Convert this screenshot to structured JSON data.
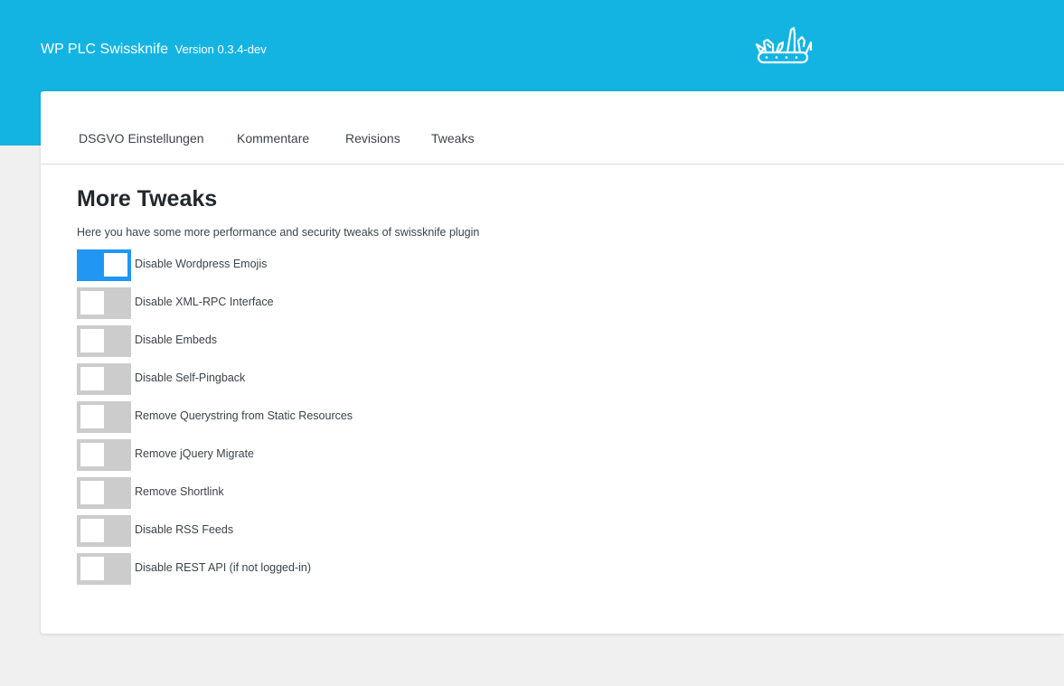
{
  "header": {
    "title": "WP PLC Swissknife",
    "version": "Version 0.3.4-dev",
    "logo_icon": "swiss-knife-icon",
    "background_color": "#13b4e2"
  },
  "tabs": [
    {
      "label": "DSGVO Einstellungen"
    },
    {
      "label": "Kommentare"
    },
    {
      "label": "Revisions"
    },
    {
      "label": "Tweaks"
    }
  ],
  "main": {
    "title": "More Tweaks",
    "description": "Here you have some more performance and security tweaks of swissknife plugin",
    "toggle_on_color": "#2196f3",
    "toggle_off_color": "#cccccc",
    "options": [
      {
        "label": "Disable Wordpress Emojis",
        "enabled": true
      },
      {
        "label": "Disable XML-RPC Interface",
        "enabled": false
      },
      {
        "label": "Disable Embeds",
        "enabled": false
      },
      {
        "label": "Disable Self-Pingback",
        "enabled": false
      },
      {
        "label": "Remove Querystring from Static Resources",
        "enabled": false
      },
      {
        "label": "Remove jQuery Migrate",
        "enabled": false
      },
      {
        "label": "Remove Shortlink",
        "enabled": false
      },
      {
        "label": "Disable RSS Feeds",
        "enabled": false
      },
      {
        "label": "Disable REST API (if not logged-in)",
        "enabled": false
      }
    ]
  }
}
